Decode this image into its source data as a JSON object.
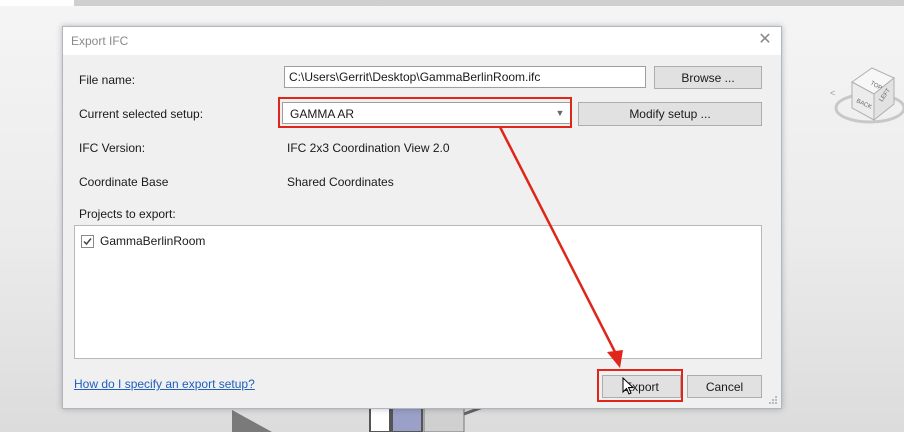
{
  "dialog": {
    "title": "Export IFC",
    "close_icon": "close-icon",
    "file_name_label": "File name:",
    "file_name_value": "C:\\Users\\Gerrit\\Desktop\\GammaBerlinRoom.ifc",
    "browse_label": "Browse ...",
    "setup_label": "Current selected setup:",
    "setup_value": "GAMMA AR",
    "modify_label": "Modify setup ...",
    "ifc_version_label": "IFC Version:",
    "ifc_version_value": "IFC 2x3 Coordination View 2.0",
    "coord_base_label": "Coordinate Base",
    "coord_base_value": "Shared Coordinates",
    "projects_label": "Projects to export:",
    "projects": [
      {
        "name": "GammaBerlinRoom",
        "checked": true
      }
    ],
    "help_link": "How do I specify an export setup?",
    "export_label": "Export",
    "cancel_label": "Cancel"
  },
  "viewcube": {
    "faces": [
      "TOP",
      "BACK",
      "LEFT"
    ]
  },
  "annotations": {
    "highlight_color": "#e0261b"
  }
}
